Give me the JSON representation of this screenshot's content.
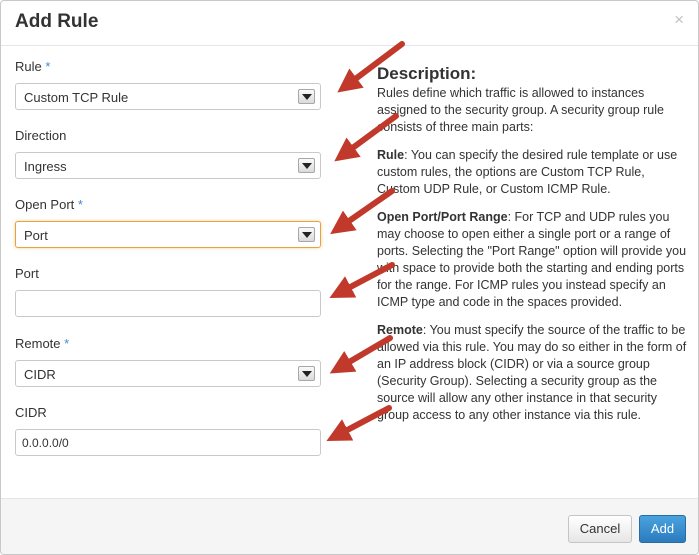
{
  "dialog": {
    "title": "Add Rule",
    "close_glyph": "×"
  },
  "form": {
    "rule": {
      "label": "Rule",
      "required": "*",
      "value": "Custom TCP Rule"
    },
    "direction": {
      "label": "Direction",
      "value": "Ingress"
    },
    "open_port": {
      "label": "Open Port",
      "required": "*",
      "value": "Port"
    },
    "port": {
      "label": "Port",
      "value": ""
    },
    "remote": {
      "label": "Remote",
      "required": "*",
      "value": "CIDR"
    },
    "cidr": {
      "label": "CIDR",
      "value": "0.0.0.0/0"
    }
  },
  "description": {
    "heading": "Description:",
    "intro": "Rules define which traffic is allowed to instances assigned to the security group. A security group rule consists of three main parts:",
    "rule_term": "Rule",
    "rule_text": ": You can specify the desired rule template or use custom rules, the options are Custom TCP Rule, Custom UDP Rule, or Custom ICMP Rule.",
    "port_term": "Open Port/Port Range",
    "port_text": ": For TCP and UDP rules you may choose to open either a single port or a range of ports. Selecting the \"Port Range\" option will provide you with space to provide both the starting and ending ports for the range. For ICMP rules you instead specify an ICMP type and code in the spaces provided.",
    "remote_term": "Remote",
    "remote_text": ": You must specify the source of the traffic to be allowed via this rule. You may do so either in the form of an IP address block (CIDR) or via a source group (Security Group). Selecting a security group as the source will allow any other instance in that security group access to any other instance via this rule."
  },
  "footer": {
    "cancel_label": "Cancel",
    "add_label": "Add"
  },
  "colors": {
    "arrow": "#c0392b",
    "primary_button": "#2b7bbf",
    "required_mark": "#428bca",
    "focus_border": "#e5a53e"
  },
  "icons": {
    "close": "close-icon",
    "dropdown": "chevron-down-icon",
    "annotation": "arrow-annotation"
  }
}
